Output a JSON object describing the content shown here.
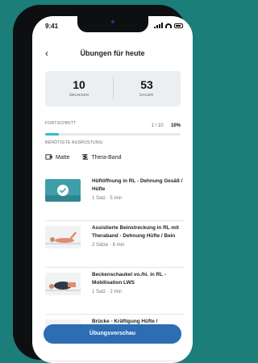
{
  "status": {
    "time": "9:41"
  },
  "header": {
    "title": "Übungen für heute",
    "back_icon": "chevron-left-icon"
  },
  "stats": [
    {
      "value": "10",
      "label": "ÜBUNGEN"
    },
    {
      "value": "53",
      "label": "DAUER"
    }
  ],
  "progress": {
    "label": "FORTSCHRITT",
    "count": "1 / 10",
    "percent": "10%",
    "value": 0.1
  },
  "equipment": {
    "label": "BENÖTIGTE AUSRÜSTUNG:",
    "items": [
      {
        "name": "Matte",
        "icon": "mat-icon"
      },
      {
        "name": "Thera-Band",
        "icon": "band-icon"
      }
    ]
  },
  "exercises": [
    {
      "name": "Hüftöffnung in RL - Dehnung Gesäß / Hüfte",
      "meta": "1 Satz · 5 min",
      "completed": true
    },
    {
      "name": "Assistierte Beinstreckung in RL mit Theraband - Dehnung Hüfte / Bein",
      "meta": "2 Sätze · 8 min",
      "completed": false
    },
    {
      "name": "Beckenschaukel vo./hi. in RL - Mobilisation LWS",
      "meta": "1 Satz · 2 min",
      "completed": false
    },
    {
      "name": "Brücke - Kräftigung Hüfte /",
      "meta": "",
      "completed": false
    }
  ],
  "cta": {
    "label": "Übungsvorschau"
  },
  "colors": {
    "background": "#1b7e78",
    "accent": "#2cc0c9",
    "button": "#2c6db3"
  }
}
